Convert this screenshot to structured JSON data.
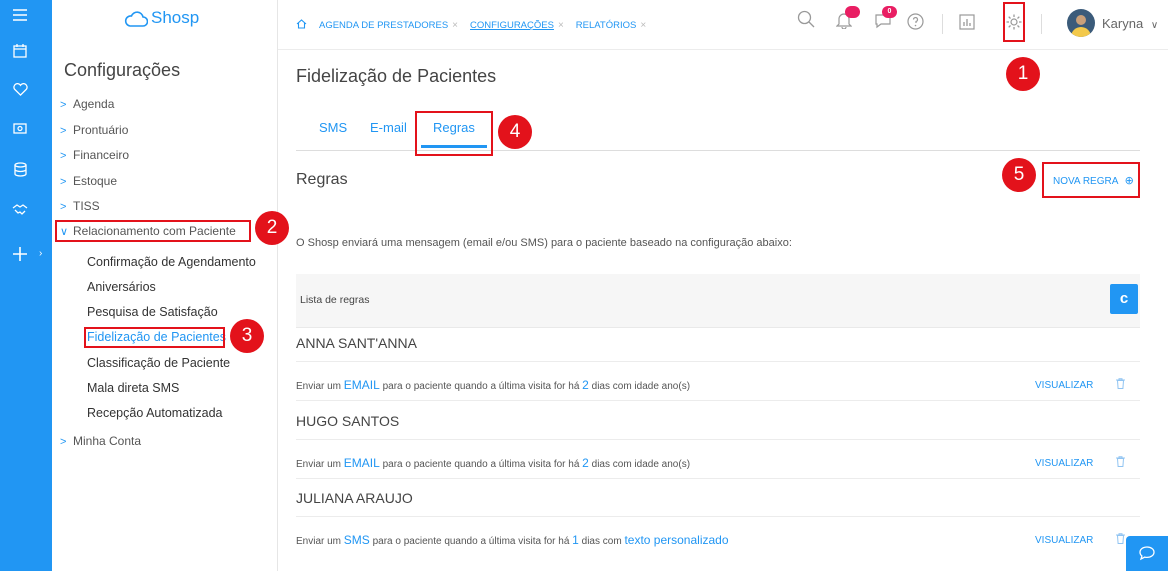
{
  "brand": {
    "name": "Shosp"
  },
  "sidebar": {
    "title": "Configurações",
    "menu": [
      {
        "label": "Agenda"
      },
      {
        "label": "Prontuário"
      },
      {
        "label": "Financeiro"
      },
      {
        "label": "Estoque"
      },
      {
        "label": "TISS"
      },
      {
        "label": "Relacionamento com Paciente"
      },
      {
        "label": "Minha Conta"
      }
    ],
    "submenu": [
      {
        "label": "Confirmação de Agendamento"
      },
      {
        "label": "Aniversários"
      },
      {
        "label": "Pesquisa de Satisfação"
      },
      {
        "label": "Fidelização de Pacientes"
      },
      {
        "label": "Classificação de Paciente"
      },
      {
        "label": "Mala direta SMS"
      },
      {
        "label": "Recepção Automatizada"
      }
    ]
  },
  "header": {
    "tabs": [
      {
        "label": "AGENDA DE PRESTADORES"
      },
      {
        "label": "CONFIGURAÇÕES"
      },
      {
        "label": "RELATÓRIOS"
      }
    ],
    "notifications_count": "",
    "messages_count": "0",
    "user_name": "Karyna"
  },
  "annotations": [
    "1",
    "2",
    "3",
    "4",
    "5"
  ],
  "main": {
    "title": "Fidelização de Pacientes",
    "subtabs": [
      {
        "label": "SMS"
      },
      {
        "label": "E-mail"
      },
      {
        "label": "Regras"
      }
    ],
    "section_title": "Regras",
    "new_rule_label": "NOVA REGRA",
    "description": "O Shosp enviará uma mensagem (email e/ou SMS) para o paciente baseado na configuração abaixo:",
    "list_header": "Lista de regras",
    "view_label": "VISUALIZAR",
    "rules": [
      {
        "name": "ANNA SANT'ANNA",
        "pre": "Enviar um",
        "channel": "EMAIL",
        "mid": "para o paciente quando a última visita for há",
        "days": "2",
        "post": "dias com idade ano(s)",
        "extra": ""
      },
      {
        "name": "HUGO SANTOS",
        "pre": "Enviar um",
        "channel": "EMAIL",
        "mid": "para o paciente quando a última visita for há",
        "days": "2",
        "post": "dias com idade ano(s)",
        "extra": ""
      },
      {
        "name": "JULIANA ARAUJO",
        "pre": "Enviar um",
        "channel": "SMS",
        "mid": "para o paciente quando a última visita for há",
        "days": "1",
        "post": "dias com",
        "extra": "texto personalizado"
      }
    ]
  }
}
